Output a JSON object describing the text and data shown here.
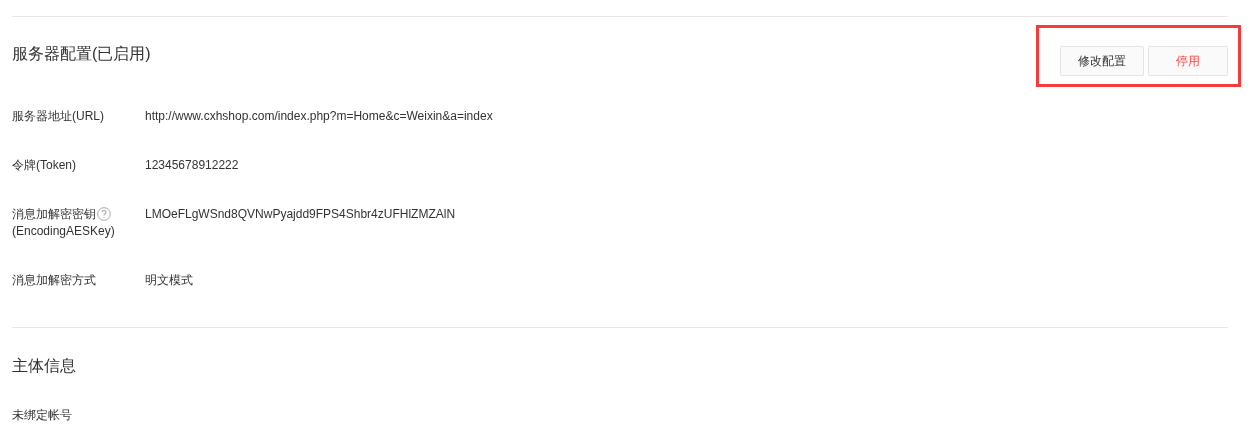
{
  "server_section": {
    "title": "服务器配置(已启用)",
    "highlighted": true,
    "buttons": [
      {
        "label": "修改配置",
        "kind": "normal"
      },
      {
        "label": "停用",
        "kind": "danger"
      }
    ],
    "fields": [
      {
        "label": "服务器地址(URL)",
        "value": "http://www.cxhshop.com/index.php?m=Home&c=Weixin&a=index"
      },
      {
        "label": "令牌(Token)",
        "value": "12345678912222"
      },
      {
        "label": "消息加解密密钥",
        "label_2": "(EncodingAESKey)",
        "help": true,
        "value": "LMOeFLgWSnd8QVNwPyajdd9FPS4Shbr4zUFHlZMZAlN"
      },
      {
        "label": "消息加解密方式",
        "value": "明文模式"
      }
    ]
  },
  "subject_section": {
    "title": "主体信息",
    "text": "未绑定帐号"
  }
}
